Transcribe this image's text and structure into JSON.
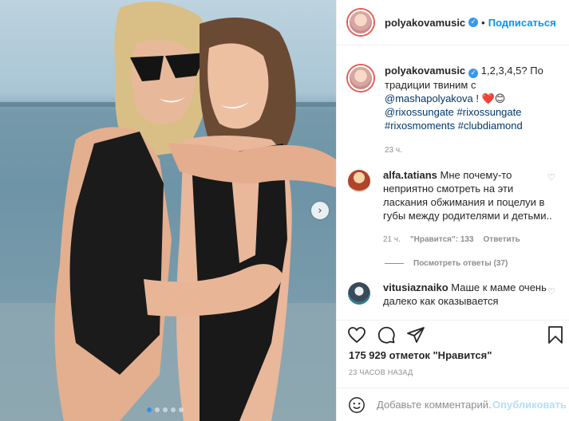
{
  "post": {
    "username": "polyakovamusic",
    "separator": "•",
    "follow_label": "Подписаться",
    "carousel": {
      "slides": 5,
      "active": 0
    }
  },
  "caption": {
    "username": "polyakovamusic",
    "text_1": "1,2,3,4,5? По традиции твиним с",
    "mention": "@mashapolyakova",
    "text_2": " ! ❤️😊",
    "tag_1": "@rixossungate",
    "tag_2": "#rixossungate",
    "tag_3": "#rixosmoments",
    "tag_4": "#clubdiamond",
    "time": "23 ч."
  },
  "comments": [
    {
      "username": "alfa.tatians",
      "text": "Мне почему-то неприятно смотреть на эти ласкания обжимания и поцелуи в губы между родителями и детьми..",
      "time": "21 ч.",
      "likes": "\"Нравится\": 133",
      "reply": "Ответить",
      "replies_label": "Посмотреть ответы (37)"
    },
    {
      "username": "vitusiaznaiko",
      "text": "Маше к маме очень далеко как оказывается"
    }
  ],
  "stats": {
    "likes": "175 929 отметок \"Нравится\"",
    "time_ago": "23 ЧАСОВ НАЗАД"
  },
  "composer": {
    "placeholder": "Добавьте комментарий...",
    "publish": "Опубликовать"
  },
  "icons": {
    "heart": "heart-icon",
    "comment": "comment-icon",
    "share": "share-icon",
    "save": "bookmark-icon",
    "emoji": "emoji-icon",
    "next": "chevron-right-icon"
  },
  "colors": {
    "link": "#0095f6",
    "tag": "#00376b",
    "muted": "#8e8e8e",
    "story_ring": "#e95950"
  }
}
